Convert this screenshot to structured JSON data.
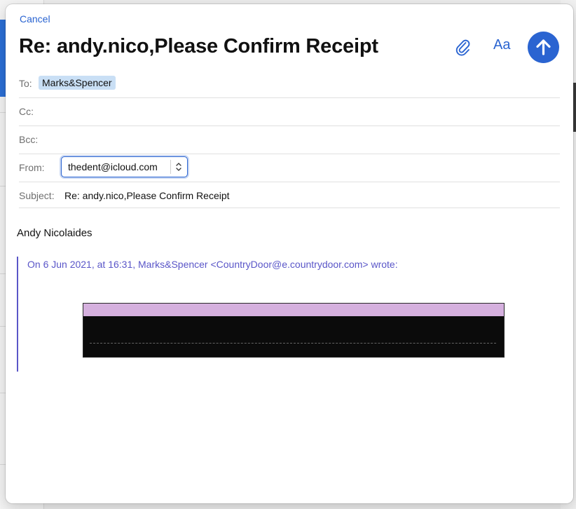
{
  "compose": {
    "cancel_label": "Cancel",
    "title": "Re: andy.nico,Please Confirm Receipt",
    "font_button_label": "Aa",
    "attach_icon": "paperclip-icon",
    "send_icon": "arrow-up-icon",
    "accent_color": "#2a64d1"
  },
  "fields": {
    "to_label": "To:",
    "to_recipient": "Marks&Spencer",
    "cc_label": "Cc:",
    "bcc_label": "Bcc:",
    "from_label": "From:",
    "from_value": "thedent@icloud.com",
    "subject_label": "Subject:",
    "subject_value": "Re: andy.nico,Please Confirm Receipt"
  },
  "message": {
    "signature": "Andy Nicolaides",
    "quote_header": "On 6 Jun 2021, at 16:31, Marks&Spencer <CountryDoor@e.countrydoor.com> wrote:",
    "quote_color": "#5a56c8"
  }
}
